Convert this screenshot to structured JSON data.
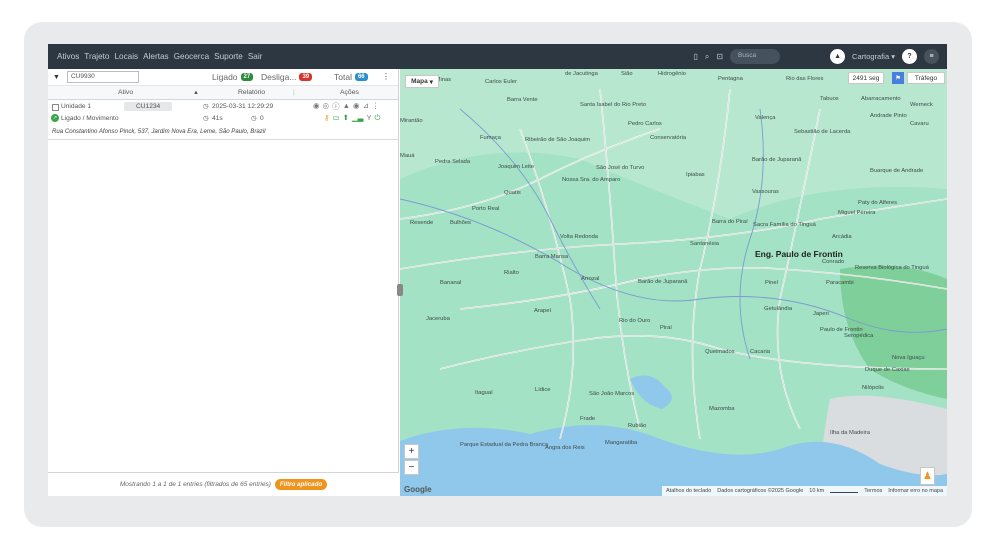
{
  "nav": [
    "Ativos",
    "Trajeto",
    "Locais",
    "Alertas",
    "Geocerca",
    "Suporte",
    "Sair"
  ],
  "header": {
    "search_placeholder": "Busca",
    "cartografia": "Cartografia",
    "cartografia_caret": "▾"
  },
  "filter": {
    "value": "CU9930",
    "ligado_label": "Ligado",
    "ligado_count": "27",
    "desligado_label": "Desliga...",
    "desligado_count": "39",
    "total_label": "Total",
    "total_count": "66",
    "colors": {
      "ligado": "#2e8b3e",
      "desligado": "#d9342b",
      "total": "#2a8fd0"
    }
  },
  "columns": {
    "ativo": "Ativo",
    "sort_icon": "▲",
    "relatorio": "Relatório",
    "acoes": "Ações"
  },
  "unit": {
    "name": "Unidade 1",
    "plate": "CU1234",
    "datetime": "2025-03-31 12:29:29",
    "status": "Ligado / Movimento",
    "duration": "41s",
    "idle": "0",
    "address": "Rua Constantino Afonso Pinck, 537, Jardim Nova Era, Leme, São Paulo, Brazil"
  },
  "footer": {
    "text": "Mostrando 1 a 1 de 1 entries (filtrados de 65 entries)",
    "filter_badge": "Filtro aplicado"
  },
  "map": {
    "type_button": "Mapa",
    "counter": "2491 seg",
    "traffic": "Tráfego",
    "zoom_in": "+",
    "zoom_out": "−",
    "google": "Google",
    "attribution": [
      "Atalhos do teclado",
      "Dados cartográficos ©2025 Google",
      "10 km",
      "Termos",
      "Informar erro no mapa"
    ],
    "places": [
      "Bocaina de Minas",
      "Carlos Euler",
      "de Jacutinga",
      "Sião",
      "Hidrogênio",
      "Pentagna",
      "Rio das Flores",
      "Tabuos",
      "Abarracamento",
      "Werneck",
      "Barra Vente",
      "Santa Isabel do Rio Preto",
      "Andrade Pinto",
      "Cavaru",
      "Mirantão",
      "Fumaça",
      "Ribeirão de São Joaquim",
      "Pedro Carlos",
      "Conservatória",
      "Valença",
      "Sebastião de Lacerda",
      "Mauá",
      "Pedra Selada",
      "Joaquim Leite",
      "São José do Turvo",
      "Barão de Juparanã",
      "Nossa Sra. do Amparo",
      "Ipiabas",
      "Buarque de Andrade",
      "Quatis",
      "Vassouras",
      "Porto Real",
      "Paty do Alferes",
      "Resende",
      "Bulhões",
      "Barra do Piraí",
      "Sacra Família do Tinguá",
      "Miguel Pereira",
      "Volta Redonda",
      "Santanésia",
      "Arcádia",
      "Barra Mansa",
      "Eng. Paulo de Frontin",
      "Conrado",
      "Rialto",
      "Arrozal",
      "Reserva Biológica do Tinguá",
      "Bananal",
      "Barão de Juparanã",
      "Pinel",
      "Paracambi",
      "Jaceruba",
      "Arapeí",
      "Getulândia",
      "Japeri",
      "Rio do Ouro",
      "Piraí",
      "Paulo de Frontin",
      "Queimados",
      "Cacaria",
      "Seropédica",
      "Nova Iguaçu",
      "Duque de Caxias",
      "Nilópolis",
      "São João Marcos",
      "Lídice",
      "Mazomba",
      "Itaguaí",
      "Rubião",
      "Ilha da Madeira",
      "Parque Estadual da Pedra Branca",
      "Angra dos Reis",
      "Mangaratiba",
      "Frade",
      "Ribeira"
    ]
  }
}
